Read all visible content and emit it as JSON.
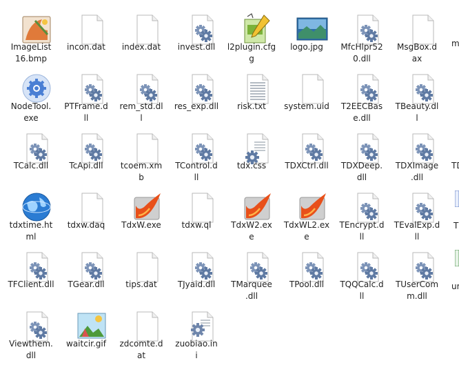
{
  "files": [
    {
      "name": "ImageList16.bmp",
      "lines": [
        "ImageList",
        "16.bmp"
      ],
      "icon": "bitmap-icon"
    },
    {
      "name": "incon.dat",
      "lines": [
        "incon.dat"
      ],
      "icon": "blank-file-icon"
    },
    {
      "name": "index.dat",
      "lines": [
        "index.dat"
      ],
      "icon": "blank-file-icon"
    },
    {
      "name": "invest.dll",
      "lines": [
        "invest.dll"
      ],
      "icon": "dll-gear-icon"
    },
    {
      "name": "l2plugin.cfg",
      "lines": [
        "l2plugin.cfg",
        "g"
      ],
      "icon": "config-icon"
    },
    {
      "name": "logo.jpg",
      "lines": [
        "logo.jpg"
      ],
      "icon": "jpeg-image-icon"
    },
    {
      "name": "MfcHlpr520.dll",
      "lines": [
        "MfcHlpr52",
        "0.dll"
      ],
      "icon": "dll-gear-icon"
    },
    {
      "name": "MsgBox.dax",
      "lines": [
        "MsgBox.d",
        "ax"
      ],
      "icon": "blank-file-icon"
    },
    {
      "name": "NodeTool.exe",
      "lines": [
        "NodeTool.",
        "exe"
      ],
      "icon": "blue-gear-exe-icon"
    },
    {
      "name": "PTFrame.dll",
      "lines": [
        "PTFrame.d",
        "ll"
      ],
      "icon": "dll-gear-icon"
    },
    {
      "name": "rem_std.dll",
      "lines": [
        "rem_std.dl",
        "l"
      ],
      "icon": "dll-gear-icon"
    },
    {
      "name": "res_exp.dll",
      "lines": [
        "res_exp.dll"
      ],
      "icon": "dll-gear-icon"
    },
    {
      "name": "risk.txt",
      "lines": [
        "risk.txt"
      ],
      "icon": "text-file-icon"
    },
    {
      "name": "system.uid",
      "lines": [
        "system.uid"
      ],
      "icon": "blank-file-icon"
    },
    {
      "name": "T2EECBase.dll",
      "lines": [
        "T2EECBas",
        "e.dll"
      ],
      "icon": "dll-gear-icon"
    },
    {
      "name": "TBeauty.dll",
      "lines": [
        "TBeauty.dl",
        "l"
      ],
      "icon": "dll-gear-icon"
    },
    {
      "name": "TCalc.dll",
      "lines": [
        "TCalc.dll"
      ],
      "icon": "dll-gear-icon"
    },
    {
      "name": "TcApi.dll",
      "lines": [
        "TcApi.dll"
      ],
      "icon": "dll-gear-icon"
    },
    {
      "name": "tcoem.xmb",
      "lines": [
        "tcoem.xm",
        "b"
      ],
      "icon": "blank-file-icon"
    },
    {
      "name": "TControl.dll",
      "lines": [
        "TControl.d",
        "ll"
      ],
      "icon": "dll-gear-icon"
    },
    {
      "name": "tdx.css",
      "lines": [
        "tdx.css"
      ],
      "icon": "css-file-icon"
    },
    {
      "name": "TDXCtrl.dll",
      "lines": [
        "TDXCtrl.dll"
      ],
      "icon": "dll-gear-icon"
    },
    {
      "name": "TDXDeep.dll",
      "lines": [
        "TDXDeep.",
        "dll"
      ],
      "icon": "dll-gear-icon"
    },
    {
      "name": "TDXImage.dll",
      "lines": [
        "TDXImage",
        ".dll"
      ],
      "icon": "dll-gear-icon"
    },
    {
      "name": "tdxtime.html",
      "lines": [
        "tdxtime.ht",
        "ml"
      ],
      "icon": "globe-html-icon"
    },
    {
      "name": "tdxw.daq",
      "lines": [
        "tdxw.daq"
      ],
      "icon": "blank-file-icon"
    },
    {
      "name": "TdxW.exe",
      "lines": [
        "TdxW.exe"
      ],
      "icon": "tdx-app-icon"
    },
    {
      "name": "tdxw.ql",
      "lines": [
        "tdxw.ql"
      ],
      "icon": "blank-file-icon"
    },
    {
      "name": "TdxW2.exe",
      "lines": [
        "TdxW2.ex",
        "e"
      ],
      "icon": "tdx-app-icon"
    },
    {
      "name": "TdxWL2.exe",
      "lines": [
        "TdxWL2.ex",
        "e"
      ],
      "icon": "tdx-app-icon"
    },
    {
      "name": "TEncrypt.dll",
      "lines": [
        "TEncrypt.d",
        "ll"
      ],
      "icon": "dll-gear-icon"
    },
    {
      "name": "TEvalExp.dll",
      "lines": [
        "TEvalExp.d",
        "ll"
      ],
      "icon": "dll-gear-icon"
    },
    {
      "name": "TFClient.dll",
      "lines": [
        "TFClient.dll"
      ],
      "icon": "dll-gear-icon"
    },
    {
      "name": "TGear.dll",
      "lines": [
        "TGear.dll"
      ],
      "icon": "dll-gear-icon"
    },
    {
      "name": "tips.dat",
      "lines": [
        "tips.dat"
      ],
      "icon": "blank-file-icon"
    },
    {
      "name": "TJyaid.dll",
      "lines": [
        "TJyaid.dll"
      ],
      "icon": "dll-gear-icon"
    },
    {
      "name": "TMarquee.dll",
      "lines": [
        "TMarquee",
        ".dll"
      ],
      "icon": "dll-gear-icon"
    },
    {
      "name": "TPool.dll",
      "lines": [
        "TPool.dll"
      ],
      "icon": "dll-gear-icon"
    },
    {
      "name": "TQQCalc.dll",
      "lines": [
        "TQQCalc.d",
        "ll"
      ],
      "icon": "dll-gear-icon"
    },
    {
      "name": "TUserComm.dll",
      "lines": [
        "TUserCom",
        "m.dll"
      ],
      "icon": "dll-gear-icon"
    },
    {
      "name": "Viewthem.dll",
      "lines": [
        "Viewthem.",
        "dll"
      ],
      "icon": "dll-gear-icon"
    },
    {
      "name": "waitcir.gif",
      "lines": [
        "waitcir.gif"
      ],
      "icon": "gif-image-icon"
    },
    {
      "name": "zdcomte.dat",
      "lines": [
        "zdcomte.d",
        "at"
      ],
      "icon": "blank-file-icon"
    },
    {
      "name": "zuobiao.ini",
      "lines": [
        "zuobiao.in",
        "i"
      ],
      "icon": "ini-settings-icon"
    }
  ],
  "partial_edge": {
    "row0": "m",
    "row2": "TD",
    "row4": "T",
    "row5": "ur"
  }
}
